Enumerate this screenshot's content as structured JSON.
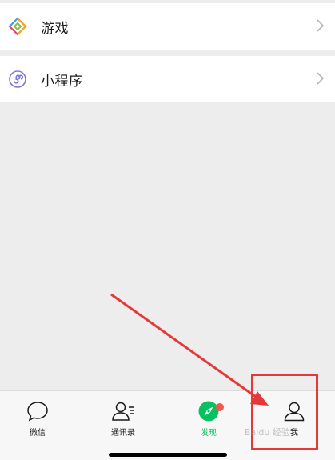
{
  "discover_list": {
    "items": [
      {
        "label": "游戏",
        "icon": "games-icon"
      },
      {
        "label": "小程序",
        "icon": "mini-programs-icon"
      }
    ]
  },
  "tabbar": {
    "tabs": [
      {
        "label": "微信",
        "icon": "chat-bubble-icon",
        "active": false
      },
      {
        "label": "通讯录",
        "icon": "contacts-icon",
        "active": false
      },
      {
        "label": "发现",
        "icon": "compass-icon",
        "active": true,
        "badge": "dot"
      },
      {
        "label": "我",
        "icon": "person-icon",
        "active": false
      }
    ]
  },
  "annotation": {
    "color": "#e5383b",
    "target": "我"
  },
  "watermark": {
    "text": "Baidu 经验"
  },
  "colors": {
    "accent": "#07c160",
    "badge": "#fa5151",
    "background": "#ededed"
  }
}
